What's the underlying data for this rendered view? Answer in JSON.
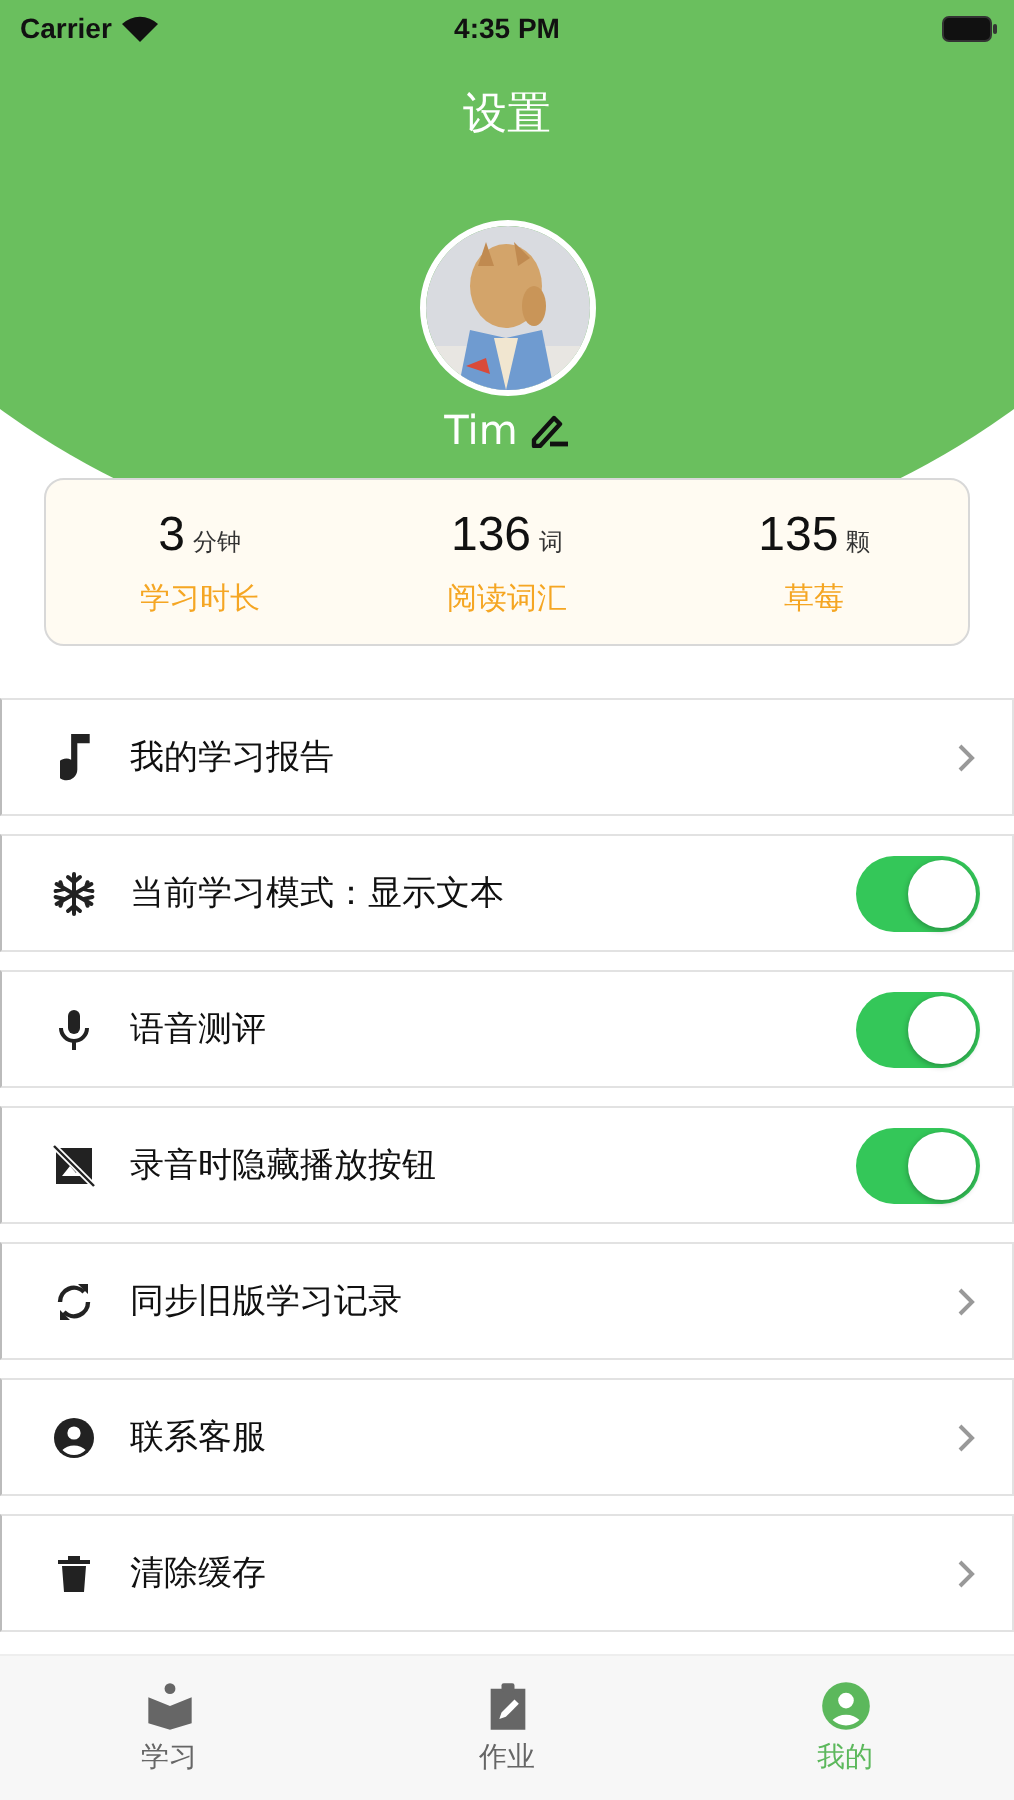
{
  "status_bar": {
    "carrier": "Carrier",
    "time": "4:35 PM"
  },
  "header": {
    "title": "设置",
    "username": "Tim"
  },
  "stats": [
    {
      "value": "3",
      "unit": "分钟",
      "label": "学习时长"
    },
    {
      "value": "136",
      "unit": "词",
      "label": "阅读词汇"
    },
    {
      "value": "135",
      "unit": "颗",
      "label": "草莓"
    }
  ],
  "settings": [
    {
      "kind": "link",
      "label": "我的学习报告"
    },
    {
      "kind": "toggle",
      "label": "当前学习模式：显示文本",
      "on": true
    },
    {
      "kind": "toggle",
      "label": "语音测评",
      "on": true
    },
    {
      "kind": "toggle",
      "label": "录音时隐藏播放按钮",
      "on": true
    },
    {
      "kind": "link",
      "label": "同步旧版学习记录"
    },
    {
      "kind": "link",
      "label": "联系客服"
    },
    {
      "kind": "link",
      "label": "清除缓存"
    }
  ],
  "tab_bar": [
    {
      "label": "学习",
      "selected": false
    },
    {
      "label": "作业",
      "selected": false
    },
    {
      "label": "我的",
      "selected": true
    }
  ]
}
